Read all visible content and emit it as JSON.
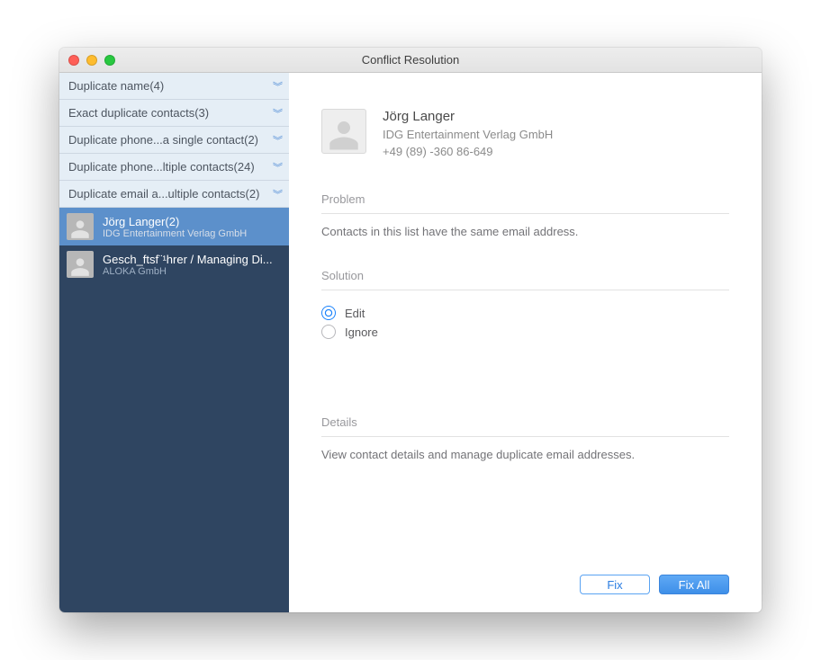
{
  "window": {
    "title": "Conflict Resolution"
  },
  "sidebar": {
    "categories": [
      {
        "label": "Duplicate name(4)"
      },
      {
        "label": "Exact duplicate contacts(3)"
      },
      {
        "label": "Duplicate phone...a single contact(2)"
      },
      {
        "label": "Duplicate phone...ltiple contacts(24)"
      },
      {
        "label": "Duplicate email a...ultiple contacts(2)"
      }
    ],
    "contacts": [
      {
        "name": "Jörg Langer(2)",
        "sub": "IDG Entertainment Verlag GmbH",
        "selected": true
      },
      {
        "name": "Gesch_ftsf¨¹hrer / Managing Di...",
        "sub": "ALOKA GmbH",
        "selected": false
      }
    ]
  },
  "detail": {
    "name": "Jörg Langer",
    "company": "IDG Entertainment Verlag GmbH",
    "phone": "+49 (89) -360 86-649",
    "problem_label": "Problem",
    "problem_text": "Contacts in this list have the same email address.",
    "solution_label": "Solution",
    "solution_options": {
      "edit": "Edit",
      "ignore": "Ignore"
    },
    "details_label": "Details",
    "details_text": "View contact details and manage duplicate email addresses."
  },
  "buttons": {
    "fix": "Fix",
    "fix_all": "Fix All"
  }
}
